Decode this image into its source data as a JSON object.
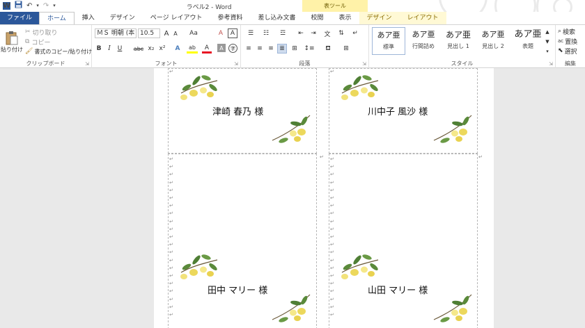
{
  "window": {
    "title": "ラベル2 - Word",
    "context_tab_group": "表ツール"
  },
  "tabs": [
    {
      "label": "ファイル",
      "kind": "file"
    },
    {
      "label": "ホーム",
      "kind": "active"
    },
    {
      "label": "挿入",
      "kind": "normal"
    },
    {
      "label": "デザイン",
      "kind": "normal"
    },
    {
      "label": "ページ レイアウト",
      "kind": "normal"
    },
    {
      "label": "参考資料",
      "kind": "normal"
    },
    {
      "label": "差し込み文書",
      "kind": "normal"
    },
    {
      "label": "校閲",
      "kind": "normal"
    },
    {
      "label": "表示",
      "kind": "normal"
    },
    {
      "label": "デザイン",
      "kind": "ctx"
    },
    {
      "label": "レイアウト",
      "kind": "ctx"
    }
  ],
  "clipboard": {
    "label": "クリップボード",
    "paste": "貼り付け",
    "cut": "切り取り",
    "copy": "コピー",
    "format_painter": "書式のコピー/貼り付け"
  },
  "font": {
    "label": "フォント",
    "family": "ＭＳ 明朝 (本",
    "size": "10.5",
    "grow": "A",
    "shrink": "A",
    "case": "Aa",
    "bold": "B",
    "italic": "I",
    "underline": "U",
    "strike": "abc",
    "subscript": "x₂",
    "superscript": "x²",
    "font_color": "A",
    "highlight": "ab",
    "text_effect": "A",
    "char_shade": "A",
    "enclose": "字",
    "clear": "A"
  },
  "paragraph": {
    "label": "段落"
  },
  "styles": {
    "label": "スタイル",
    "items": [
      {
        "preview": "あア亜",
        "name": "標準"
      },
      {
        "preview": "あア亜",
        "name": "行間詰め"
      },
      {
        "preview": "あア亜",
        "name": "見出し 1"
      },
      {
        "preview": "あア亜",
        "name": "見出し 2"
      },
      {
        "preview": "あア亜",
        "name": "表題"
      }
    ]
  },
  "editing": {
    "label": "編集",
    "find": "検索",
    "replace": "置換",
    "select": "選択"
  },
  "document": {
    "paragraph_mark": "↵",
    "labels": [
      {
        "name": "津崎 春乃 様"
      },
      {
        "name": "川中子 風沙 様"
      },
      {
        "name": "田中 マリー 様"
      },
      {
        "name": "山田 マリー 様"
      }
    ]
  },
  "colors": {
    "word_blue": "#2b579a",
    "context_tab_bg": "#fff2a8",
    "font_color_bar": "#e81123",
    "highlight_bar": "#ffff00"
  }
}
